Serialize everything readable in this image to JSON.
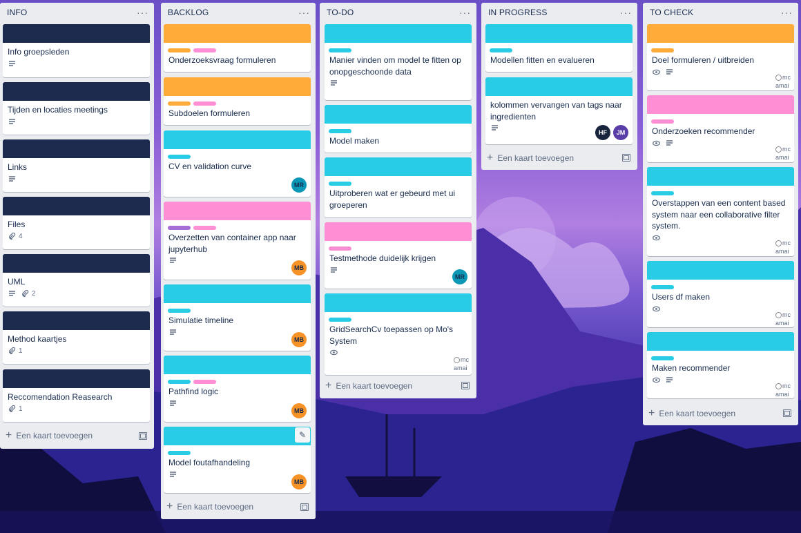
{
  "colors": {
    "navy": "#1c2a4d",
    "orange": "#ffab39",
    "cyan": "#29cce5",
    "pink": "#ff8ed4",
    "purple": "#a66cd8"
  },
  "common": {
    "add_card": "Een kaart toevoegen",
    "menu": "···",
    "broken_img": "mc amai"
  },
  "lists": [
    {
      "title": "INFO",
      "cards": [
        {
          "title": "Info groepsleden",
          "attachments": ""
        },
        {
          "title": "Tijden en locaties meetings"
        },
        {
          "title": "Links"
        },
        {
          "title": "Files",
          "attachments": "4"
        },
        {
          "title": "UML",
          "attachments": "2"
        },
        {
          "title": "Method kaartjes",
          "attachments": "1"
        },
        {
          "title": "Reccomendation Reasearch",
          "attachments": "1"
        }
      ]
    },
    {
      "title": "BACKLOG",
      "cards": [
        {
          "title": "Onderzoeksvraag formuleren"
        },
        {
          "title": "Subdoelen formuleren"
        },
        {
          "title": "CV en validation curve",
          "avatar": "MR"
        },
        {
          "title": "Overzetten van container app naar jupyterhub",
          "avatar": "MB"
        },
        {
          "title": "Simulatie timeline",
          "avatar": "MB"
        },
        {
          "title": "Pathfind logic",
          "avatar": "MB"
        },
        {
          "title": "Model foutafhandeling",
          "avatar": "MB"
        }
      ]
    },
    {
      "title": "TO-DO",
      "cards": [
        {
          "title": "Manier vinden om model te fitten op onopgeschoonde data"
        },
        {
          "title": "Model maken"
        },
        {
          "title": "Uitproberen wat er gebeurd met ui groeperen"
        },
        {
          "title": "Testmethode duidelijk krijgen",
          "avatar": "MR"
        },
        {
          "title": "GridSearchCv toepassen op Mo's System"
        }
      ]
    },
    {
      "title": "IN PROGRESS",
      "cards": [
        {
          "title": "Modellen fitten en evalueren"
        },
        {
          "title": "kolommen vervangen van tags naar ingredienten",
          "avatars": [
            "HF",
            "JM"
          ]
        }
      ]
    },
    {
      "title": "TO CHECK",
      "cards": [
        {
          "title": "Doel formuleren / uitbreiden"
        },
        {
          "title": "Onderzoeken recommender"
        },
        {
          "title": "Overstappen van een content based system naar een collaborative filter system."
        },
        {
          "title": "Users df maken"
        },
        {
          "title": "Maken recommender"
        }
      ]
    }
  ]
}
